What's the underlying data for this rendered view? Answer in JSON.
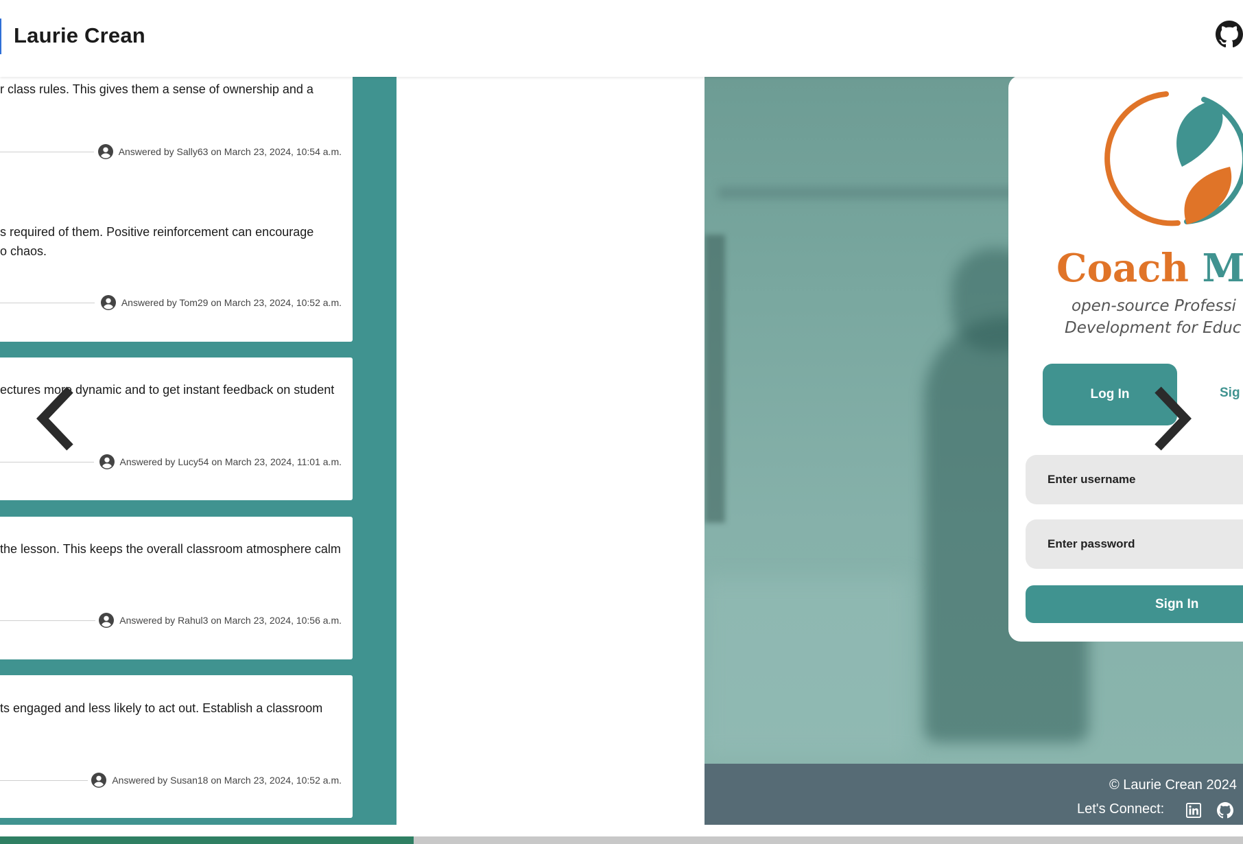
{
  "header": {
    "title": "Laurie Crean"
  },
  "answers": [
    {
      "text": "r class rules. This gives them a sense of ownership and a",
      "meta": "Answered by Sally63 on March 23, 2024, 10:54 a.m."
    },
    {
      "text": "s required of them. Positive reinforcement can encourage",
      "text2": "o chaos.",
      "meta": "Answered by Tom29 on March 23, 2024, 10:52 a.m."
    },
    {
      "text": "ectures more dynamic and to get instant feedback on student",
      "meta": "Answered by Lucy54 on March 23, 2024, 11:01 a.m."
    },
    {
      "text": " the lesson. This keeps the overall classroom atmosphere calm",
      "meta": "Answered by Rahul3 on March 23, 2024, 10:56 a.m."
    },
    {
      "text": "ts engaged and less likely to act out. Establish a classroom",
      "meta": "Answered by Susan18 on March 23, 2024, 10:52 a.m."
    }
  ],
  "login": {
    "brand_first": "Coach ",
    "brand_second": "Mat",
    "tagline_1": "open-source Professi",
    "tagline_2": "Development for Educ",
    "tab_login": "Log In",
    "tab_signup": "Sig",
    "username_placeholder": "Enter username",
    "password_placeholder": "Enter password",
    "submit": "Sign In"
  },
  "footer": {
    "copyright": "© Laurie Crean 2024",
    "connect": "Let's Connect:"
  },
  "colors": {
    "teal": "#409390",
    "orange": "#e07428",
    "footer": "#566b75",
    "scroll_thumb": "#2f7f63"
  },
  "icons": [
    "github-icon",
    "user-avatar-icon",
    "chevron-left-icon",
    "chevron-right-icon",
    "linkedin-icon"
  ]
}
